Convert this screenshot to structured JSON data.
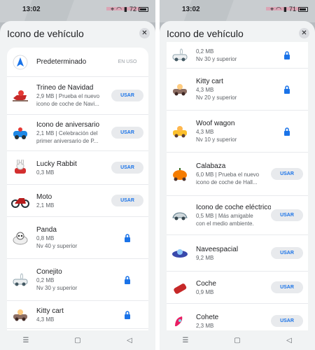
{
  "status": {
    "time": "13:02",
    "battery_left": "72",
    "battery_right": "71"
  },
  "sheet": {
    "title": "Icono de vehículo",
    "close_icon": "close-icon"
  },
  "buttons": {
    "use": "USAR",
    "in_use": "EN USO"
  },
  "left_items": [
    {
      "name": "Predeterminado",
      "sub": "",
      "sub2": "",
      "action": "in_use",
      "icon": "navigation-arrow-icon"
    },
    {
      "name": "Trineo de Navidad",
      "sub": "2,9 MB | Prueba el nuevo",
      "sub2": "icono de coche de Navi...",
      "action": "use",
      "icon": "christmas-sleigh-icon"
    },
    {
      "name": "Icono de aniversario",
      "sub": "2,1 MB | Celebración del",
      "sub2": "primer aniversario de P...",
      "action": "use",
      "icon": "anniversary-car-icon"
    },
    {
      "name": "Lucky Rabbit",
      "sub": "0,3 MB",
      "sub2": "",
      "action": "use",
      "icon": "lucky-rabbit-icon"
    },
    {
      "name": "Moto",
      "sub": "2,1 MB",
      "sub2": "",
      "action": "use",
      "icon": "motorcycle-icon"
    },
    {
      "name": "Panda",
      "sub": "0,8 MB",
      "sub2": "Nv 40 y superior",
      "action": "locked",
      "icon": "panda-icon"
    },
    {
      "name": "Conejito",
      "sub": "0,2 MB",
      "sub2": "Nv 30 y superior",
      "action": "locked",
      "icon": "bunny-car-icon"
    },
    {
      "name": "Kitty cart",
      "sub": "4,3 MB",
      "sub2": "",
      "action": "locked",
      "icon": "kitty-cart-icon"
    }
  ],
  "right_items": [
    {
      "name": "",
      "sub": "0,2 MB",
      "sub2": "Nv 30 y superior",
      "action": "locked",
      "icon": "bunny-car-icon"
    },
    {
      "name": "Kitty cart",
      "sub": "4,3 MB",
      "sub2": "Nv 20 y superior",
      "action": "locked",
      "icon": "kitty-cart-icon"
    },
    {
      "name": "Woof wagon",
      "sub": "4,3 MB",
      "sub2": "Nv 10 y superior",
      "action": "locked",
      "icon": "woof-wagon-icon"
    },
    {
      "name": "Calabaza",
      "sub": "6,0 MB | Prueba el nuevo",
      "sub2": "icono de coche de Hall...",
      "action": "use",
      "icon": "pumpkin-car-icon"
    },
    {
      "name": "Icono de coche eléctrico",
      "sub": "0,5 MB | Más amigable",
      "sub2": "con el medio ambiente.",
      "action": "use",
      "icon": "electric-car-icon"
    },
    {
      "name": "Naveespacial",
      "sub": "9,2 MB",
      "sub2": "",
      "action": "use",
      "icon": "spaceship-icon"
    },
    {
      "name": "Coche",
      "sub": "0,9 MB",
      "sub2": "",
      "action": "use",
      "icon": "car-icon"
    },
    {
      "name": "Cohete",
      "sub": "2,3 MB",
      "sub2": "",
      "action": "use",
      "icon": "rocket-icon"
    }
  ],
  "navbar": {
    "menu_icon": "menu-icon",
    "home_icon": "home-icon",
    "back_icon": "back-icon"
  }
}
